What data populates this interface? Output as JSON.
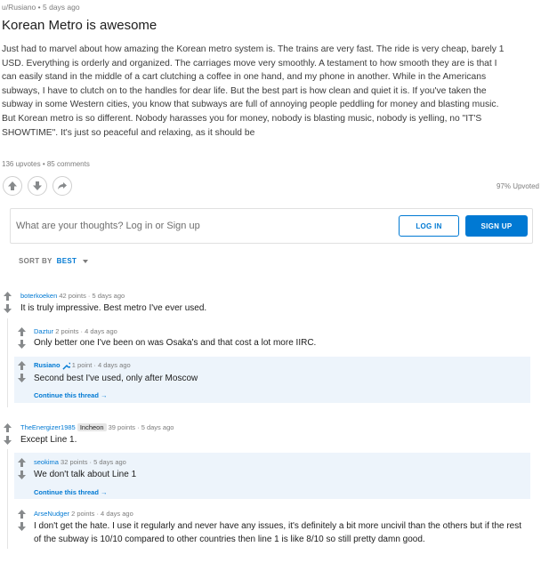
{
  "post": {
    "author": "u/Rusiano",
    "sep": "•",
    "age": "5 days ago",
    "title": "Korean Metro is awesome",
    "body": "Just had to marvel about how amazing the Korean metro system is. The trains are very fast. The ride is very cheap, barely 1 USD. Everything is orderly and organized. The carriages move very smoothly. A testament to how smooth they are is that I can easily stand in the middle of a cart clutching a coffee in one hand, and my phone in another. While in the Americans subways, I have to clutch on to the handles for dear life. But the best part is how clean and quiet it is. If you've taken the subway in some Western cities, you know that subways are full of annoying people peddling for money and blasting music. But Korean metro is so different. Nobody harasses you for money, nobody is blasting music, nobody is yelling, no \"IT'S SHOWTIME\". It's just so peaceful and relaxing, as it should be",
    "stats": "136 upvotes • 85 comments",
    "upvoted": "97% Upvoted"
  },
  "comment_box": {
    "placeholder": "What are your thoughts? Log in or Sign up",
    "login_label": "LOG IN",
    "signup_label": "SIGN UP"
  },
  "sort": {
    "label": "SORT BY",
    "value": "BEST"
  },
  "comments": [
    {
      "author": "boterkoeken",
      "meta": "42 points · 5 days ago",
      "text": "It is truly impressive. Best metro I've ever used."
    },
    {
      "author": "Daztur",
      "meta": "2 points · 4 days ago",
      "text": "Only better one I've been on was Osaka's and that cost a lot more IIRC."
    },
    {
      "author": "Rusiano",
      "meta": "1 point · 4 days ago",
      "text": "Second best I've used, only after Moscow",
      "continue": "Continue this thread →"
    },
    {
      "author": "TheEnergizer1985",
      "flair": "Incheon",
      "meta": "39 points · 5 days ago",
      "text": "Except Line 1."
    },
    {
      "author": "seokima",
      "meta": "32 points · 5 days ago",
      "text": "We don't talk about Line 1",
      "continue": "Continue this thread →"
    },
    {
      "author": "ArseNudger",
      "meta": "2 points · 4 days ago",
      "text": "I don't get the hate. I use it regularly and never have any issues, it's definitely a bit more uncivil than the others but if the rest of the subway is 10/10 compared to other countries then line 1 is like 8/10 so still pretty damn good."
    }
  ],
  "colors": {
    "accent": "#0079d3",
    "highlight": "#edf4fb",
    "muted": "#7c7c7c"
  }
}
